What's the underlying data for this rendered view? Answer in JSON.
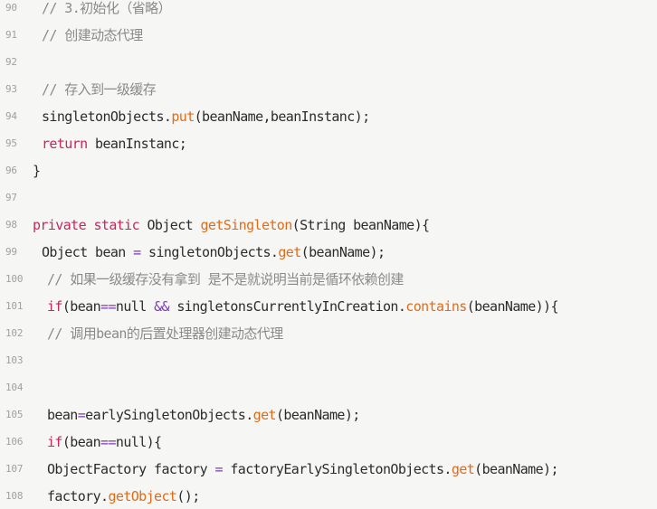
{
  "lines": [
    {
      "num": "90",
      "tokens": [
        {
          "t": "// 3.初始化（省略）",
          "c": "comment"
        }
      ]
    },
    {
      "num": "91",
      "tokens": [
        {
          "t": "// 创建动态代理",
          "c": "comment"
        }
      ]
    },
    {
      "num": "92",
      "tokens": []
    },
    {
      "num": "93",
      "tokens": [
        {
          "t": "// 存入到一级缓存",
          "c": "comment"
        }
      ]
    },
    {
      "num": "94",
      "tokens": [
        {
          "t": "singletonObjects.",
          "c": "plain"
        },
        {
          "t": "put",
          "c": "func"
        },
        {
          "t": "(beanName,beanInstanc);",
          "c": "plain"
        }
      ]
    },
    {
      "num": "95",
      "tokens": [
        {
          "t": "return",
          "c": "keyword"
        },
        {
          "t": " beanInstanc;",
          "c": "plain"
        }
      ]
    },
    {
      "num": "96",
      "tokens": [
        {
          "t": "}",
          "c": "plain"
        }
      ]
    },
    {
      "num": "97",
      "tokens": []
    },
    {
      "num": "98",
      "tokens": [
        {
          "t": "private",
          "c": "keyword"
        },
        {
          "t": " ",
          "c": "plain"
        },
        {
          "t": "static",
          "c": "keyword"
        },
        {
          "t": " Object ",
          "c": "plain"
        },
        {
          "t": "getSingleton",
          "c": "func"
        },
        {
          "t": "(String beanName){",
          "c": "plain"
        }
      ]
    },
    {
      "num": "99",
      "tokens": [
        {
          "t": "Object bean ",
          "c": "plain"
        },
        {
          "t": "=",
          "c": "op"
        },
        {
          "t": " singletonObjects.",
          "c": "plain"
        },
        {
          "t": "get",
          "c": "func"
        },
        {
          "t": "(beanName);",
          "c": "plain"
        }
      ]
    },
    {
      "num": "100",
      "tokens": [
        {
          "t": "// 如果一级缓存没有拿到 是不是就说明当前是循环依赖创建",
          "c": "comment"
        }
      ]
    },
    {
      "num": "101",
      "tokens": [
        {
          "t": "if",
          "c": "keyword"
        },
        {
          "t": "(bean",
          "c": "plain"
        },
        {
          "t": "==",
          "c": "op"
        },
        {
          "t": "null ",
          "c": "plain"
        },
        {
          "t": "&&",
          "c": "op"
        },
        {
          "t": " singletonsCurrentlyInCreation.",
          "c": "plain"
        },
        {
          "t": "contains",
          "c": "func"
        },
        {
          "t": "(beanName)){",
          "c": "plain"
        }
      ]
    },
    {
      "num": "102",
      "tokens": [
        {
          "t": "// 调用bean的后置处理器创建动态代理",
          "c": "comment"
        }
      ]
    },
    {
      "num": "103",
      "tokens": []
    },
    {
      "num": "104",
      "tokens": []
    },
    {
      "num": "105",
      "tokens": [
        {
          "t": "bean",
          "c": "plain"
        },
        {
          "t": "=",
          "c": "op"
        },
        {
          "t": "earlySingletonObjects.",
          "c": "plain"
        },
        {
          "t": "get",
          "c": "func"
        },
        {
          "t": "(beanName);",
          "c": "plain"
        }
      ]
    },
    {
      "num": "106",
      "tokens": [
        {
          "t": "if",
          "c": "keyword"
        },
        {
          "t": "(bean",
          "c": "plain"
        },
        {
          "t": "==",
          "c": "op"
        },
        {
          "t": "null){",
          "c": "plain"
        }
      ]
    },
    {
      "num": "107",
      "tokens": [
        {
          "t": "ObjectFactory factory ",
          "c": "plain"
        },
        {
          "t": "=",
          "c": "op"
        },
        {
          "t": " factoryEarlySingletonObjects.",
          "c": "plain"
        },
        {
          "t": "get",
          "c": "func"
        },
        {
          "t": "(beanName);",
          "c": "plain"
        }
      ]
    },
    {
      "num": "108",
      "tokens": [
        {
          "t": "factory.",
          "c": "plain"
        },
        {
          "t": "getObject",
          "c": "func"
        },
        {
          "t": "();",
          "c": "plain"
        }
      ]
    }
  ]
}
